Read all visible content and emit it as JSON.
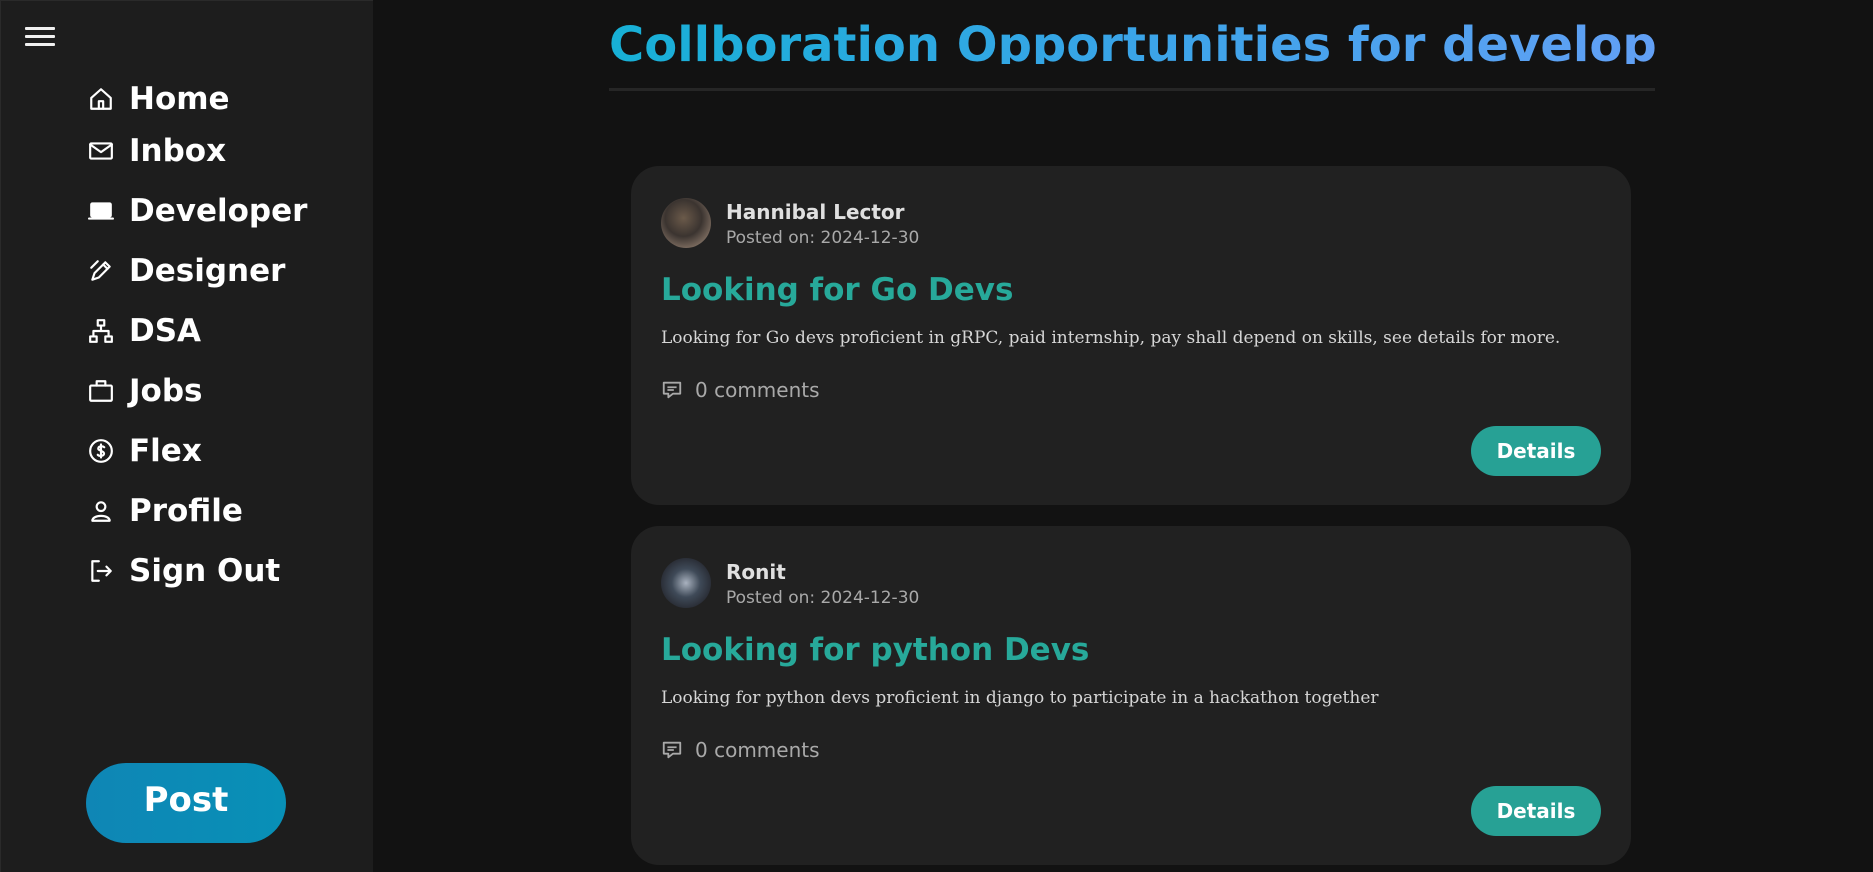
{
  "sidebar": {
    "menu_icon": "hamburger-menu-icon",
    "items": [
      {
        "label": "Home",
        "icon": "home-icon"
      },
      {
        "label": "Inbox",
        "icon": "mail-icon"
      },
      {
        "label": "Developer",
        "icon": "laptop-icon"
      },
      {
        "label": "Designer",
        "icon": "pen-tool-icon"
      },
      {
        "label": "DSA",
        "icon": "hierarchy-icon"
      },
      {
        "label": "Jobs",
        "icon": "briefcase-icon"
      },
      {
        "label": "Flex",
        "icon": "dollar-icon"
      },
      {
        "label": "Profile",
        "icon": "user-icon"
      },
      {
        "label": "Sign Out",
        "icon": "logout-icon"
      }
    ],
    "post_label": "Post"
  },
  "main": {
    "title": "Collboration Opportunities for developers",
    "posts": [
      {
        "author": "Hannibal Lector",
        "posted": "Posted on: 2024-12-30",
        "title": "Looking for Go Devs",
        "description": "Looking for Go devs proficient in gRPC, paid internship, pay shall depend on skills, see details for more.",
        "comments": "0 comments",
        "details_label": "Details"
      },
      {
        "author": "Ronit",
        "posted": "Posted on: 2024-12-30",
        "title": "Looking for python Devs",
        "description": "Looking for python devs proficient in django to participate in a hackathon together",
        "comments": "0 comments",
        "details_label": "Details"
      }
    ]
  },
  "colors": {
    "accent_gradient_start": "#17b0d6",
    "accent_gradient_end": "#62a0f5",
    "post_title": "#27a99a",
    "details_button": "#27a195",
    "post_button": "#0f86b5"
  }
}
